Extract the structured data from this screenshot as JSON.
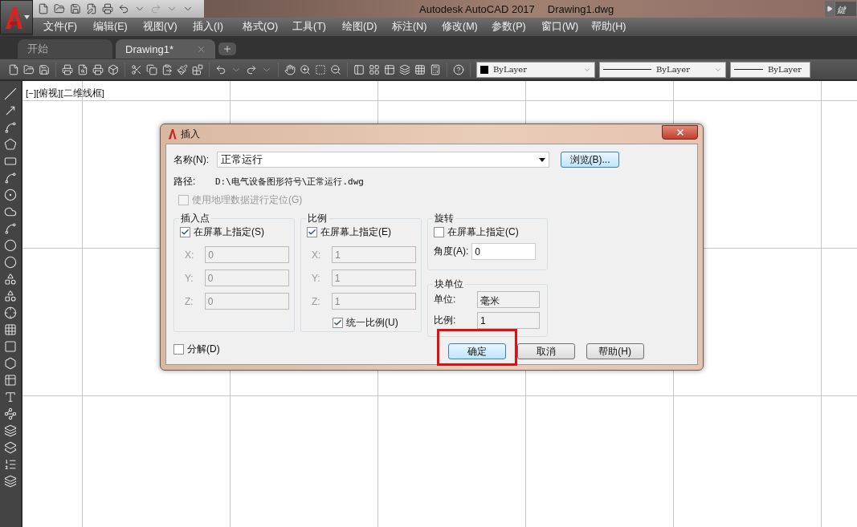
{
  "app": {
    "title": "Autodesk AutoCAD 2017",
    "document": "Drawing1.dwg",
    "search_hint": "鍵"
  },
  "menu": [
    "文件(F)",
    "编辑(E)",
    "视图(V)",
    "插入(I)",
    "格式(O)",
    "工具(T)",
    "绘图(D)",
    "标注(N)",
    "修改(M)",
    "参数(P)",
    "窗口(W)",
    "帮助(H)"
  ],
  "doc_tabs": [
    {
      "label": "开始",
      "selected": false,
      "closable": false
    },
    {
      "label": "Drawing1*",
      "selected": true,
      "closable": true
    }
  ],
  "property_controls": [
    {
      "kind": "color",
      "value": "ByLayer"
    },
    {
      "kind": "linetype",
      "value": "ByLayer"
    },
    {
      "kind": "lineweight",
      "value": "ByLayer"
    }
  ],
  "viewport_label": "[−][俯视][二维线框]",
  "dialog": {
    "title": "插入",
    "name": {
      "label": "名称(N):",
      "value": "正常运行"
    },
    "browse": "浏览(B)...",
    "path": {
      "label": "路径:",
      "value": "D:\\电气设备图形符号\\正常运行.dwg"
    },
    "geo": {
      "label": "使用地理数据进行定位(G)",
      "checked": false,
      "disabled": true
    },
    "insertion": {
      "title": "插入点",
      "specify": {
        "label": "在屏幕上指定(S)",
        "checked": true
      },
      "fields": [
        {
          "label": "X:",
          "value": "0",
          "disabled": true
        },
        {
          "label": "Y:",
          "value": "0",
          "disabled": true
        },
        {
          "label": "Z:",
          "value": "0",
          "disabled": true
        }
      ]
    },
    "scale": {
      "title": "比例",
      "specify": {
        "label": "在屏幕上指定(E)",
        "checked": true
      },
      "fields": [
        {
          "label": "X:",
          "value": "1",
          "disabled": true
        },
        {
          "label": "Y:",
          "value": "1",
          "disabled": true
        },
        {
          "label": "Z:",
          "value": "1",
          "disabled": true
        }
      ],
      "uniform": {
        "label": "统一比例(U)",
        "checked": true
      }
    },
    "rotation": {
      "title": "旋转",
      "specify": {
        "label": "在屏幕上指定(C)",
        "checked": false
      },
      "angle": {
        "label": "角度(A):",
        "value": "0"
      }
    },
    "block_unit": {
      "title": "块单位",
      "unit": {
        "label": "单位:",
        "value": "毫米"
      },
      "factor": {
        "label": "比例:",
        "value": "1"
      }
    },
    "explode": {
      "label": "分解(D)",
      "checked": false
    },
    "buttons": [
      {
        "label": "确定",
        "default": true,
        "highlighted": true
      },
      {
        "label": "取消",
        "default": false,
        "highlighted": false
      },
      {
        "label": "帮助(H)",
        "default": false,
        "highlighted": false
      }
    ]
  }
}
